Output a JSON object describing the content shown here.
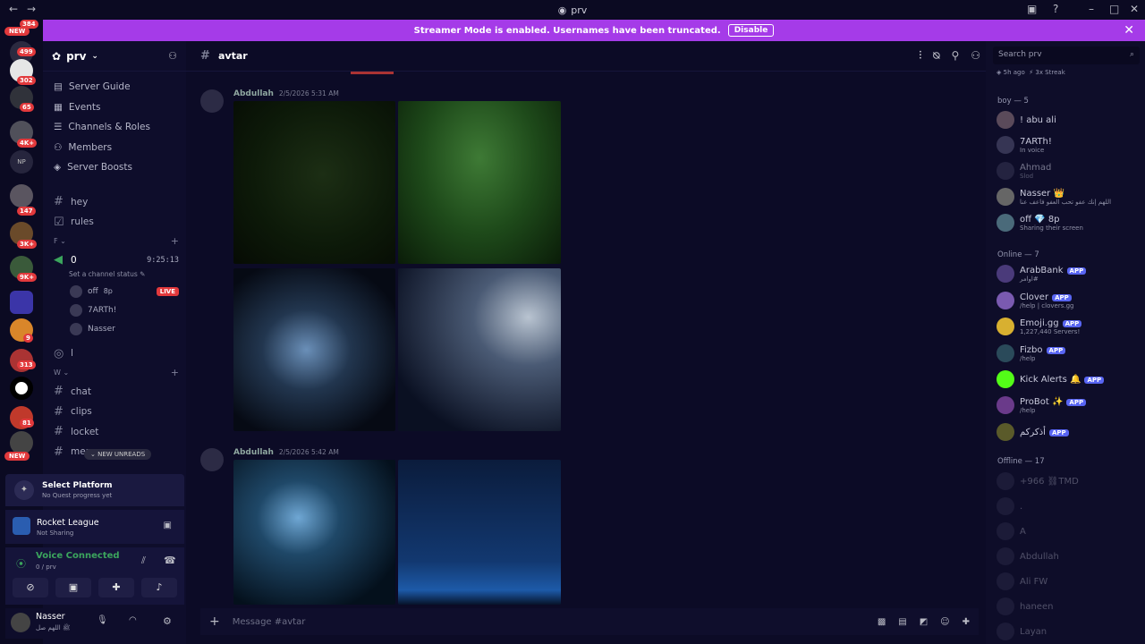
{
  "window": {
    "title": "prv"
  },
  "banner": {
    "text": "Streamer Mode is enabled. Usernames have been truncated.",
    "button": "Disable"
  },
  "server_badges": [
    "384",
    "NEW",
    "499",
    "302",
    "65",
    "4K+",
    "NP",
    "147",
    "3K+",
    "9K+",
    "9",
    "313",
    "81",
    "NEW"
  ],
  "guild": {
    "name": "prv"
  },
  "nav": [
    "Server Guide",
    "Events",
    "Channels & Roles",
    "Members",
    "Server Boosts"
  ],
  "channels_top": [
    "hey",
    "rules"
  ],
  "category_f": "F",
  "voice": {
    "name": "0",
    "timer": "9:25:13",
    "status": "Set a channel status",
    "users": [
      {
        "name": "off",
        "tag": "8p",
        "live": "LIVE"
      },
      {
        "name": "7ARTh!"
      },
      {
        "name": "Nasser"
      }
    ]
  },
  "stage": "l",
  "category_w": "W",
  "channels_w": [
    "chat",
    "clips",
    "locket",
    "memes"
  ],
  "new_unreads": "NEW UNREADS",
  "quest": {
    "title": "Select Platform",
    "sub": "No Quest progress yet"
  },
  "activity": {
    "title": "Rocket League",
    "sub": "Not Sharing"
  },
  "voice_conn": {
    "title": "Voice Connected",
    "sub": "0 / prv"
  },
  "user": {
    "name": "Nasser",
    "status": "ﷺ اللهم صل"
  },
  "channel": {
    "name": "avtar"
  },
  "messages": [
    {
      "author": "Abdullah",
      "time": "2/5/2026 5:31 AM"
    },
    {
      "author": "Abdullah",
      "time": "2/5/2026 5:42 AM"
    }
  ],
  "composer": {
    "placeholder": "Message #avtar"
  },
  "search": {
    "placeholder": "Search prv"
  },
  "member_top": {
    "ago": "5h ago",
    "streak": "3x Streak"
  },
  "groups": [
    {
      "title": "boy — 5",
      "members": [
        {
          "name": "! abu ali",
          "sub": ""
        },
        {
          "name": "7ARTh!",
          "sub": "In voice"
        },
        {
          "name": "Ahmad",
          "sub": "Slod"
        },
        {
          "name": "Nasser 👑",
          "sub": "اللهم إنك عفو تحب العفو فاعف عنا"
        },
        {
          "name": "off 💎 8p",
          "sub": "Sharing their screen"
        }
      ]
    },
    {
      "title": "Online — 7",
      "members": [
        {
          "name": "ArabBank",
          "sub": "اوامر#",
          "app": "APP"
        },
        {
          "name": "Clover",
          "sub": "/help | clovers.gg",
          "app": "APP"
        },
        {
          "name": "Emoji.gg",
          "sub": "1,227,440 Servers!",
          "app": "APP"
        },
        {
          "name": "Fizbo",
          "sub": "/help",
          "app": "APP"
        },
        {
          "name": "Kick Alerts 🔔",
          "sub": "",
          "app": "APP"
        },
        {
          "name": "ProBot ✨",
          "sub": "/help",
          "app": "APP"
        },
        {
          "name": "أذكركم",
          "sub": "",
          "app": "APP"
        }
      ]
    },
    {
      "title": "Offline — 17",
      "members": [
        {
          "name": "+966 ⛓TMD",
          "sub": ""
        },
        {
          "name": ".",
          "sub": ""
        },
        {
          "name": "A",
          "sub": ""
        },
        {
          "name": "Abdullah",
          "sub": ""
        },
        {
          "name": "Ali FW",
          "sub": ""
        },
        {
          "name": "haneen",
          "sub": ""
        },
        {
          "name": "Layan",
          "sub": ""
        }
      ]
    }
  ]
}
